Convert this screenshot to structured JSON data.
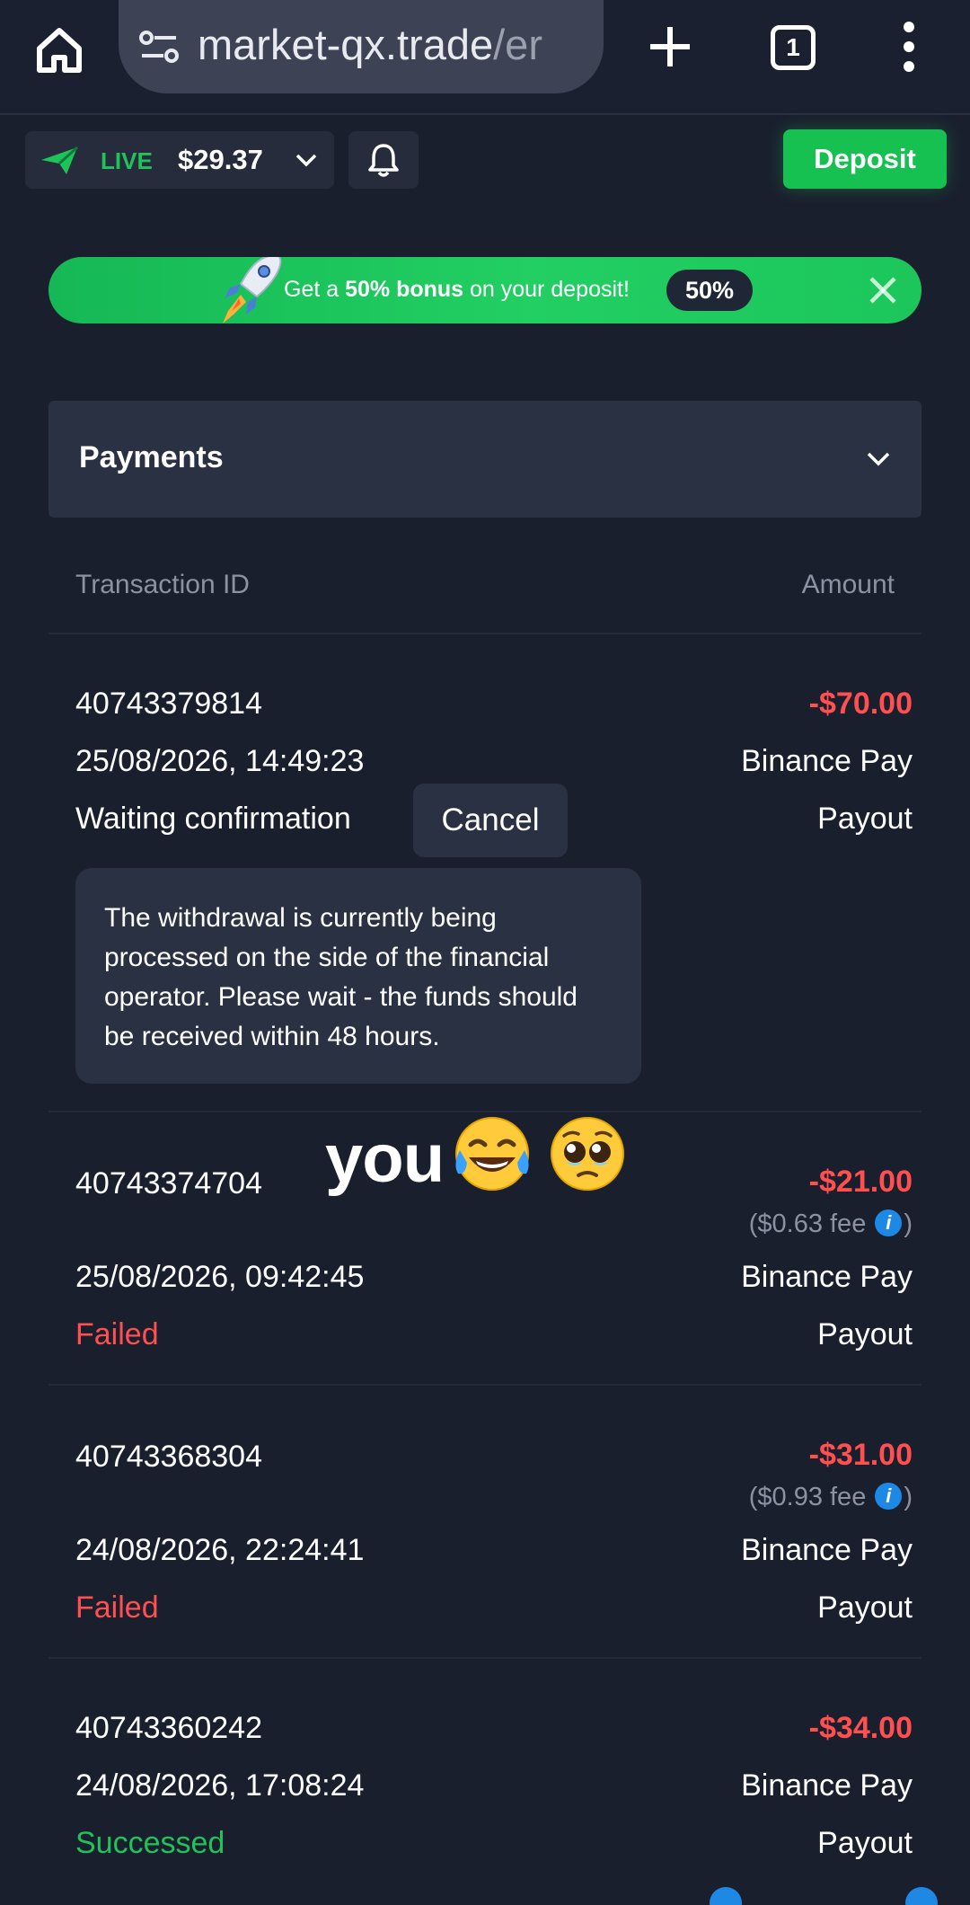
{
  "browser": {
    "url_host": "market-qx.trade",
    "url_rest": "/er",
    "tab_count": "1"
  },
  "header": {
    "account_mode": "LIVE",
    "balance": "$29.37",
    "deposit_label": "Deposit"
  },
  "banner": {
    "text_prefix": "Get a ",
    "text_bold": "50% bonus",
    "text_suffix": " on your deposit!",
    "badge": "50%"
  },
  "payments": {
    "title": "Payments",
    "columns": {
      "transaction_id": "Transaction ID",
      "amount": "Amount"
    },
    "transactions": [
      {
        "id": "40743379814",
        "datetime": "25/08/2026, 14:49:23",
        "status": "Waiting confirmation",
        "amount": "-$70.00",
        "method": "Binance Pay",
        "type": "Payout",
        "action": "Cancel",
        "notice": "The withdrawal is currently being processed on the side of the financial operator. Please wait - the funds should be received within 48 hours."
      },
      {
        "id": "40743374704",
        "datetime": "25/08/2026, 09:42:45",
        "status": "Failed",
        "amount": "-$21.00",
        "fee_prefix": "($0.63 fee",
        "fee_suffix": ")",
        "method": "Binance Pay",
        "type": "Payout"
      },
      {
        "id": "40743368304",
        "datetime": "24/08/2026, 22:24:41",
        "status": "Failed",
        "amount": "-$31.00",
        "fee_prefix": "($0.93 fee",
        "fee_suffix": ")",
        "method": "Binance Pay",
        "type": "Payout"
      },
      {
        "id": "40743360242",
        "datetime": "24/08/2026, 17:08:24",
        "status": "Successed",
        "amount": "-$34.00",
        "method": "Binance Pay",
        "type": "Payout"
      }
    ]
  },
  "overlay": {
    "caption": "you",
    "emojis": [
      "tears-of-joy-emoji",
      "pleading-face-emoji"
    ]
  },
  "colors": {
    "background": "#1a1f2e",
    "accent_green": "#16c152",
    "negative_red": "#ff4f4f",
    "panel": "#2a3142",
    "muted": "#8b93a3",
    "info_blue": "#1e88e5"
  }
}
